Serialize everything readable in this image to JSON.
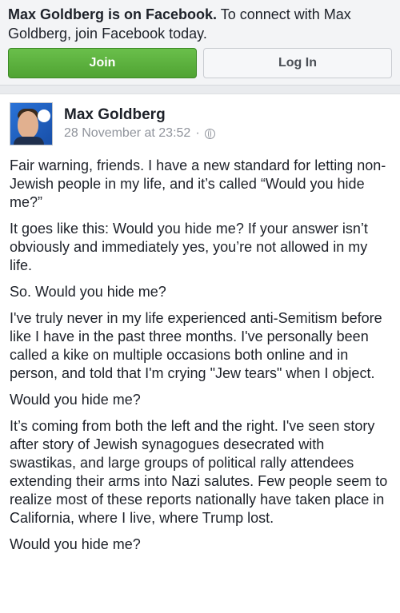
{
  "banner": {
    "name_bold": "Max Goldberg is on Facebook.",
    "message": " To connect with Max Goldberg, join Facebook today.",
    "join_label": "Join",
    "login_label": "Log In"
  },
  "post": {
    "author": "Max Goldberg",
    "timestamp": "28 November at 23:52",
    "separator": "·",
    "privacy_icon": "globe-icon",
    "paragraphs": [
      "Fair warning, friends. I have a new standard for letting non-Jewish people in my life, and it’s called “Would you hide me?”",
      "It goes like this: Would you hide me? If your answer isn’t obviously and immediately yes, you’re not allowed in my life.",
      "So. Would you hide me?",
      "I've truly never in my life experienced anti-Semitism before like I have in the past three months. I've personally been called a kike on multiple occasions both online and in person, and told that I'm crying \"Jew tears\" when I object.",
      "Would you hide me?",
      "It’s coming from both the left and the right. I've seen story after story of Jewish synagogues desecrated with swastikas, and large groups of political rally attendees extending their arms into Nazi salutes. Few people seem to realize most of these reports nationally have taken place in California, where I live, where Trump lost.",
      "Would you hide me?"
    ]
  },
  "colors": {
    "join_green": "#4fa332",
    "meta_gray": "#90949c",
    "text": "#1d2129"
  }
}
